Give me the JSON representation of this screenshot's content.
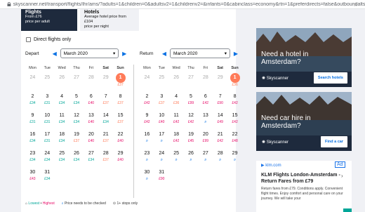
{
  "browser": {
    "url": "skyscanner.net/transport/flights/lhr/ams/?adults=1&children=0&adultsv2=1&childrenv2=&infants=0&cabinclass=economy&rtn=1&preferdirects=false&outboundaltsena..."
  },
  "tabs": {
    "flights": {
      "title": "Flights",
      "line1": "From £76",
      "line2": "price per adult"
    },
    "hotels": {
      "title": "Hotels",
      "line1": "Average hotel price from £104",
      "line2": "price per night"
    }
  },
  "direct_label": "Direct flights only",
  "depart": {
    "label": "Depart",
    "month": "March 2020"
  },
  "return": {
    "label": "Return",
    "month": "March 2020"
  },
  "weekdays": [
    "Mon",
    "Tue",
    "Wed",
    "Thu",
    "Fri",
    "Sat",
    "Sun"
  ],
  "depart_days": [
    {
      "n": "24",
      "past": true
    },
    {
      "n": "25",
      "past": true
    },
    {
      "n": "26",
      "past": true
    },
    {
      "n": "27",
      "past": true
    },
    {
      "n": "28",
      "past": true
    },
    {
      "n": "29",
      "past": true
    },
    {
      "n": "1",
      "p": "£37",
      "c": "o",
      "sel": true
    },
    {
      "n": "2",
      "p": "£34",
      "c": "g"
    },
    {
      "n": "3",
      "p": "£31",
      "c": "g"
    },
    {
      "n": "4",
      "p": "£34",
      "c": "g"
    },
    {
      "n": "5",
      "p": "£34",
      "c": "g"
    },
    {
      "n": "6",
      "p": "£40",
      "c": "r"
    },
    {
      "n": "7",
      "p": "£37",
      "c": "o"
    },
    {
      "n": "8",
      "p": "£37",
      "c": "o"
    },
    {
      "n": "9",
      "p": "£31",
      "c": "g"
    },
    {
      "n": "10",
      "p": "£31",
      "c": "g"
    },
    {
      "n": "11",
      "p": "£34",
      "c": "g"
    },
    {
      "n": "12",
      "p": "£34",
      "c": "g"
    },
    {
      "n": "13",
      "p": "£40",
      "c": "r"
    },
    {
      "n": "14",
      "p": "£34",
      "c": "g"
    },
    {
      "n": "15",
      "p": "£37",
      "c": "o"
    },
    {
      "n": "16",
      "p": "£34",
      "c": "g"
    },
    {
      "n": "17",
      "p": "£31",
      "c": "g"
    },
    {
      "n": "18",
      "p": "£34",
      "c": "g"
    },
    {
      "n": "19",
      "p": "£37",
      "c": "o"
    },
    {
      "n": "20",
      "p": "£40",
      "c": "r"
    },
    {
      "n": "21",
      "p": "£37",
      "c": "o"
    },
    {
      "n": "22",
      "p": "£40",
      "c": "r"
    },
    {
      "n": "23",
      "p": "£34",
      "c": "g"
    },
    {
      "n": "24",
      "p": "£34",
      "c": "g"
    },
    {
      "n": "25",
      "p": "£34",
      "c": "g"
    },
    {
      "n": "26",
      "p": "£34",
      "c": "g"
    },
    {
      "n": "27",
      "p": "£34",
      "c": "g"
    },
    {
      "n": "28",
      "p": "£37",
      "c": "o"
    },
    {
      "n": "29",
      "p": "£40",
      "c": "r"
    },
    {
      "n": "30",
      "p": "£43",
      "c": "r"
    },
    {
      "n": "31",
      "p": "£34",
      "c": "g"
    },
    {
      "n": ""
    },
    {
      "n": ""
    },
    {
      "n": ""
    },
    {
      "n": ""
    },
    {
      "n": ""
    }
  ],
  "return_days": [
    {
      "n": "24",
      "past": true
    },
    {
      "n": "25",
      "past": true
    },
    {
      "n": "26",
      "past": true
    },
    {
      "n": "27",
      "past": true
    },
    {
      "n": "28",
      "past": true
    },
    {
      "n": "29",
      "past": true
    },
    {
      "n": "1",
      "p": "£36",
      "c": "o",
      "sel": true
    },
    {
      "n": "2",
      "p": "£42",
      "c": "r"
    },
    {
      "n": "3",
      "p": "£37",
      "c": "o"
    },
    {
      "n": "4",
      "p": "£36",
      "c": "o"
    },
    {
      "n": "5",
      "p": "£99",
      "c": "r"
    },
    {
      "n": "6",
      "p": "£42",
      "c": "r"
    },
    {
      "n": "7",
      "p": "£90",
      "c": "r"
    },
    {
      "n": "8",
      "p": "£42",
      "c": "r"
    },
    {
      "n": "9",
      "p": "£42",
      "c": "r"
    },
    {
      "n": "10",
      "p": "£40",
      "c": "r"
    },
    {
      "n": "11",
      "p": "£42",
      "c": "r"
    },
    {
      "n": "12",
      "p": "£42",
      "c": "r"
    },
    {
      "n": "13",
      "q": true
    },
    {
      "n": "14",
      "p": "£49",
      "c": "r"
    },
    {
      "n": "15",
      "p": "£42",
      "c": "r"
    },
    {
      "n": "16",
      "q": true
    },
    {
      "n": "17",
      "q": true
    },
    {
      "n": "18",
      "p": "£42",
      "c": "r"
    },
    {
      "n": "19",
      "p": "£45",
      "c": "r"
    },
    {
      "n": "20",
      "p": "£99",
      "c": "r"
    },
    {
      "n": "21",
      "p": "£42",
      "c": "r"
    },
    {
      "n": "22",
      "p": "£48",
      "c": "r"
    },
    {
      "n": "23",
      "q": true
    },
    {
      "n": "24",
      "q": true
    },
    {
      "n": "25",
      "q": true
    },
    {
      "n": "26",
      "q": true
    },
    {
      "n": "27",
      "q": true
    },
    {
      "n": "28",
      "q": true
    },
    {
      "n": "29",
      "q": true
    },
    {
      "n": "30",
      "q": true
    },
    {
      "n": "31",
      "p": "£90",
      "c": "r"
    },
    {
      "n": ""
    },
    {
      "n": ""
    },
    {
      "n": ""
    },
    {
      "n": ""
    },
    {
      "n": ""
    }
  ],
  "legend": {
    "lowest": "Lowest",
    "sep": " • ",
    "highest": "Highest",
    "checked": "Price needs to be checked",
    "stops": "1+ stops only"
  },
  "ads": {
    "hotel": {
      "headline": "Need a hotel in Amsterdam?",
      "brand": "Skyscanner",
      "button": "Search hotels"
    },
    "car": {
      "headline": "Need car hire in Amsterdam?",
      "brand": "Skyscanner",
      "button": "Find a car"
    },
    "klm": {
      "domain": "klm.com",
      "badge": "Ad",
      "title": "KLM Flights London-Amsterdam - Return Fares from £79",
      "body": "Return fares from £79. Conditions apply. Convenient flight times. Enjoy comfort and personal care on your journey. We will take your"
    }
  },
  "colors": {
    "lowest": "#00a698",
    "highest": "#e70866",
    "selected": "#ff7b59",
    "navy": "#1e2a3d",
    "link": "#0770e3"
  }
}
